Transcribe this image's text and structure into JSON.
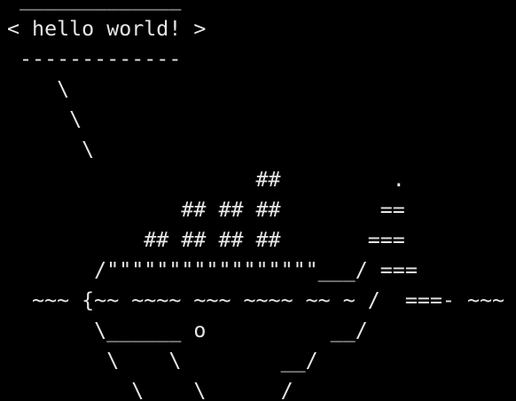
{
  "terminal": {
    "background": "#000000",
    "foreground": "#e6e6e6",
    "lines": [
      " _____________",
      "< hello world! >",
      " -------------",
      "    \\",
      "     \\",
      "      \\",
      "                    ##         .",
      "              ## ## ##        ==",
      "           ## ## ## ##       ===",
      "       /\"\"\"\"\"\"\"\"\"\"\"\"\"\"\"\"\"___/ ===",
      "  ~~~ {~~ ~~~~ ~~~ ~~~~ ~~ ~ /  ===- ~~~",
      "       \\______ o          __/",
      "        \\    \\        __/",
      "          \\____\\______/"
    ]
  }
}
